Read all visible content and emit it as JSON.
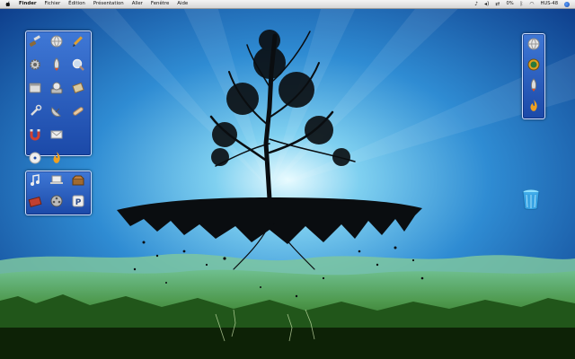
{
  "menubar": {
    "apple_icon": "apple-icon",
    "app_name": "Finder",
    "items": [
      "Fichier",
      "Édition",
      "Présentation",
      "Aller",
      "Fenêtre",
      "Aide"
    ],
    "battery": "0%",
    "clock": "HUS-48"
  },
  "left_drawer": {
    "icons": [
      "brush-icon",
      "globe-icon",
      "pencil-icon",
      "gear-icon",
      "rocket-icon",
      "magnifier-icon",
      "app-window-icon",
      "disk-utility-icon",
      "stamp-icon",
      "wrench-icon",
      "satellite-dish-icon",
      "bandage-icon",
      "magnet-icon",
      "envelope-icon",
      "cd-icon",
      "flame-icon"
    ]
  },
  "media_drawer": {
    "icons": [
      "music-note-icon",
      "laptop-icon",
      "chest-icon",
      "toolbox-icon",
      "film-reel-icon",
      "p-icon"
    ]
  },
  "right_drawer": {
    "icons": [
      "globe-icon",
      "badge-icon",
      "rocket-icon",
      "flame-icon"
    ]
  },
  "desktop": {
    "trash_icon": "trash-icon"
  }
}
